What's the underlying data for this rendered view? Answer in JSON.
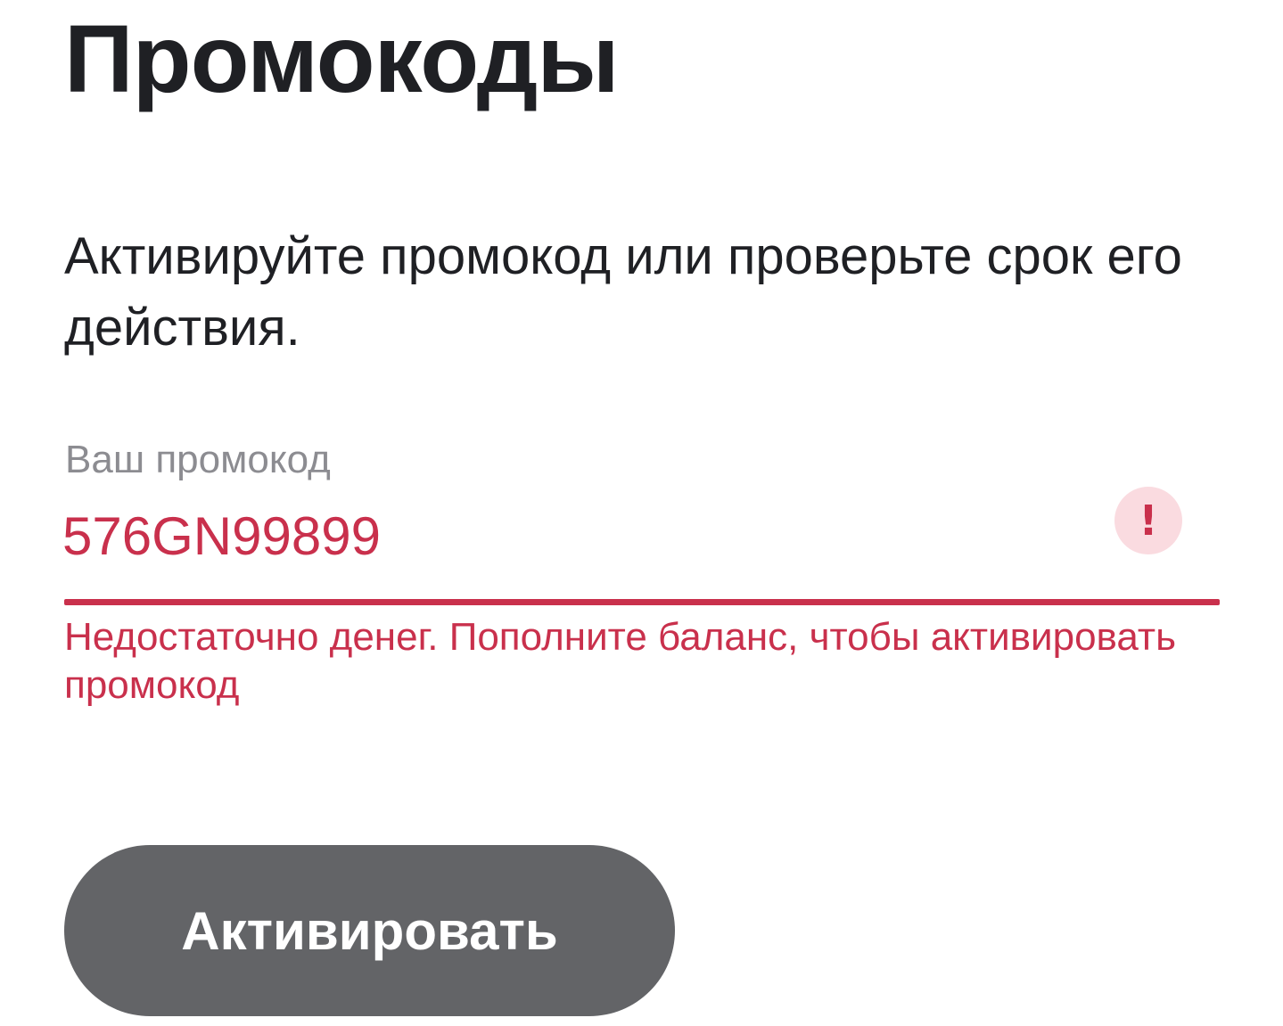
{
  "page": {
    "title": "Промокоды",
    "description": "Активируйте промокод или проверьте срок его действия."
  },
  "promo_field": {
    "label": "Ваш промокод",
    "value": "576GN99899",
    "state": "error",
    "error_icon": "exclamation-icon",
    "error_icon_glyph": "!",
    "error_message": "Недостаточно денег. Пополните баланс, чтобы активировать промокод"
  },
  "actions": {
    "activate_label": "Активировать"
  },
  "colors": {
    "text_primary": "#1f2024",
    "label_gray": "#8c8c91",
    "error_red": "#c9304c",
    "error_icon_bg": "#fadbe0",
    "button_disabled_bg": "#636467",
    "button_text": "#ffffff",
    "background": "#ffffff"
  }
}
